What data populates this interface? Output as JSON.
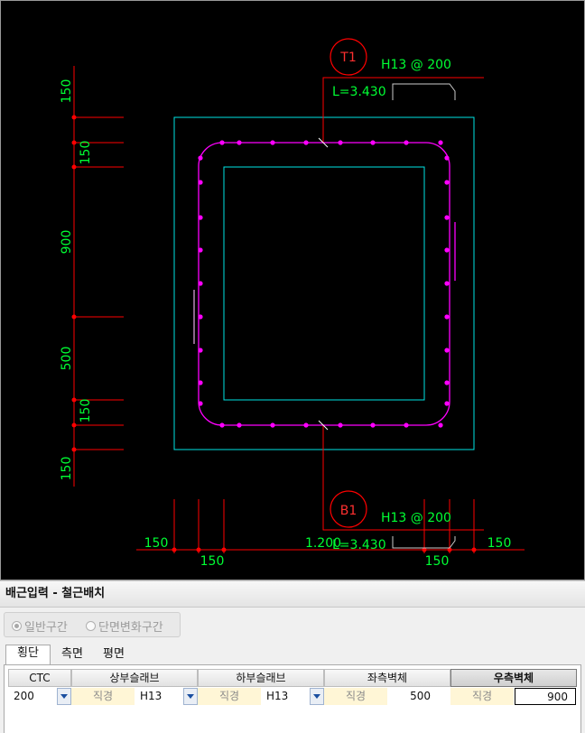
{
  "drawing": {
    "left_dims": [
      "150",
      "150",
      "900",
      "500",
      "150",
      "150"
    ],
    "bottom_dims": [
      "150",
      "150",
      "1.200",
      "150",
      "150"
    ],
    "top_tag": "T1",
    "top_bar": "H13 @ 200",
    "top_length": "L=3.430",
    "bottom_tag": "B1",
    "bottom_bar": "H13 @ 200",
    "bottom_length": "L=3.430",
    "colors": {
      "dimension": "#00ff33",
      "outline": "#00e5e5",
      "rebar": "#ff00ff",
      "leader": "#ff0000"
    }
  },
  "panel": {
    "title": "배근입력 - 철근배치",
    "mode_general": "일반구간",
    "mode_change": "단면변화구간",
    "tabs": [
      "횡단",
      "측면",
      "평면"
    ],
    "headers": {
      "ctc": "CTC",
      "top_slab": "상부슬래브",
      "bottom_slab": "하부슬래브",
      "left_wall": "좌측벽체",
      "right_wall": "우측벽체"
    },
    "row": {
      "ctc": "200",
      "top_label": "직경",
      "top_value": "H13",
      "bottom_label": "직경",
      "bottom_value": "H13",
      "left_label": "직경",
      "left_value": "500",
      "right_label": "직경",
      "right_value": "900"
    }
  }
}
